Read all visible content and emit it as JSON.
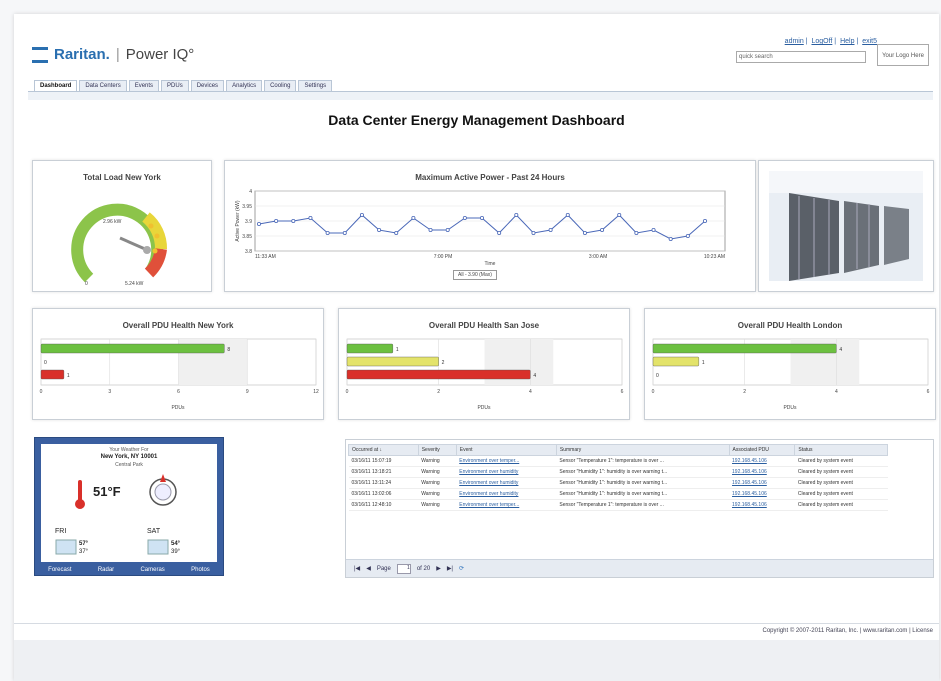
{
  "header": {
    "brand": "Raritan.",
    "product": "Power IQ°",
    "links": [
      "admin",
      "LogOff",
      "Help",
      "exit5"
    ],
    "quick_search_placeholder": "quick search",
    "your_logo": "Your Logo Here"
  },
  "tabs": [
    "Dashboard",
    "Data Centers",
    "Events",
    "PDUs",
    "Devices",
    "Analytics",
    "Cooling",
    "Settings"
  ],
  "page_title": "Data Center Energy Management Dashboard",
  "gauge": {
    "title": "Total Load New York",
    "value_label": "2.96 kW",
    "min_label": "0",
    "max_label": "5.24 kW"
  },
  "power_chart": {
    "title": "Maximum Active Power - Past 24 Hours",
    "ylabel": "Active Power (kW)",
    "xlabel": "Time",
    "yticks": [
      "4",
      "3.95",
      "3.9",
      "3.85",
      "3.8"
    ],
    "xticks": [
      "11:33 AM",
      "7:00 PM",
      "3:00 AM",
      "10:23 AM"
    ],
    "legend": "All - 3.90 (Max)"
  },
  "health": [
    {
      "title": "Overall PDU Health New York",
      "xlabel": "PDUs",
      "ticks": [
        "0",
        "3",
        "6",
        "9",
        "12"
      ],
      "bars": [
        {
          "label": "8",
          "value": 8,
          "color": "#6cc040"
        },
        {
          "label": "0",
          "value": 0,
          "color": "#e3e36a"
        },
        {
          "label": "1",
          "value": 1,
          "color": "#d9302a"
        }
      ],
      "max": 12
    },
    {
      "title": "Overall PDU Health San Jose",
      "xlabel": "PDUs",
      "ticks": [
        "0",
        "2",
        "4",
        "6"
      ],
      "bars": [
        {
          "label": "1",
          "value": 1,
          "color": "#6cc040"
        },
        {
          "label": "2",
          "value": 2,
          "color": "#e3e36a"
        },
        {
          "label": "4",
          "value": 4,
          "color": "#d9302a"
        }
      ],
      "max": 6
    },
    {
      "title": "Overall PDU Health London",
      "xlabel": "PDUs",
      "ticks": [
        "0",
        "2",
        "4",
        "6"
      ],
      "bars": [
        {
          "label": "4",
          "value": 4,
          "color": "#6cc040"
        },
        {
          "label": "1",
          "value": 1,
          "color": "#e3e36a"
        },
        {
          "label": "0",
          "value": 0,
          "color": "#d9302a"
        }
      ],
      "max": 6
    }
  ],
  "weather": {
    "heading": "Your Weather For",
    "city": "New York, NY 10001",
    "sub": "Central Park",
    "temp": "51°F",
    "days": [
      {
        "day": "FRI",
        "hi": "57°",
        "lo": "37°"
      },
      {
        "day": "SAT",
        "hi": "54°",
        "lo": "39°"
      }
    ],
    "links": [
      "Forecast",
      "Radar",
      "Cameras",
      "Photos"
    ]
  },
  "events": {
    "columns": [
      "Occurred at ↓",
      "Severity",
      "Event",
      "Summary",
      "Associated PDU",
      "Status"
    ],
    "rows": [
      [
        "03/16/11 15:07:19",
        "Warning",
        "Environment over temper...",
        "Sensor \"Temperature 1\": temperature is over ...",
        "192.168.45.106",
        "Cleared by system event"
      ],
      [
        "03/16/11 13:18:21",
        "Warning",
        "Environment over humidity",
        "Sensor \"Humidity 1\": humidity is over warning t...",
        "192.168.45.106",
        "Cleared by system event"
      ],
      [
        "03/16/11 13:11:24",
        "Warning",
        "Environment over humidity",
        "Sensor \"Humidity 1\": humidity is over warning t...",
        "192.168.45.106",
        "Cleared by system event"
      ],
      [
        "03/16/11 13:02:06",
        "Warning",
        "Environment over humidity",
        "Sensor \"Humidity 1\": humidity is over warning t...",
        "192.168.45.106",
        "Cleared by system event"
      ],
      [
        "03/16/11 12:48:10",
        "Warning",
        "Environment over temper...",
        "Sensor \"Temperature 1\": temperature is over ...",
        "192.168.45.106",
        "Cleared by system event"
      ]
    ],
    "pager": {
      "page_label": "Page",
      "page": "1",
      "of": "of 20"
    }
  },
  "footer": "Copyright © 2007-2011 Raritan, Inc. | www.raritan.com | License",
  "chart_data": [
    {
      "type": "line",
      "title": "Maximum Active Power - Past 24 Hours",
      "xlabel": "Time",
      "ylabel": "Active Power (kW)",
      "ylim": [
        3.8,
        4.0
      ],
      "series": [
        {
          "name": "All - 3.90 (Max)",
          "values": [
            3.89,
            3.9,
            3.9,
            3.91,
            3.86,
            3.86,
            3.92,
            3.87,
            3.86,
            3.91,
            3.87,
            3.87,
            3.91,
            3.91,
            3.86,
            3.92,
            3.86,
            3.87,
            3.92,
            3.86,
            3.87,
            3.92,
            3.86,
            3.87,
            3.84,
            3.85,
            3.9
          ]
        }
      ],
      "x_tick_labels": [
        "11:33 AM",
        "7:00 PM",
        "3:00 AM",
        "10:23 AM"
      ]
    },
    {
      "type": "bar",
      "title": "Overall PDU Health New York",
      "xlabel": "PDUs",
      "values": [
        8,
        0,
        1
      ],
      "xlim": [
        0,
        12
      ]
    },
    {
      "type": "bar",
      "title": "Overall PDU Health San Jose",
      "xlabel": "PDUs",
      "values": [
        1,
        2,
        4
      ],
      "xlim": [
        0,
        6
      ]
    },
    {
      "type": "bar",
      "title": "Overall PDU Health London",
      "xlabel": "PDUs",
      "values": [
        4,
        1,
        0
      ],
      "xlim": [
        0,
        6
      ]
    }
  ]
}
